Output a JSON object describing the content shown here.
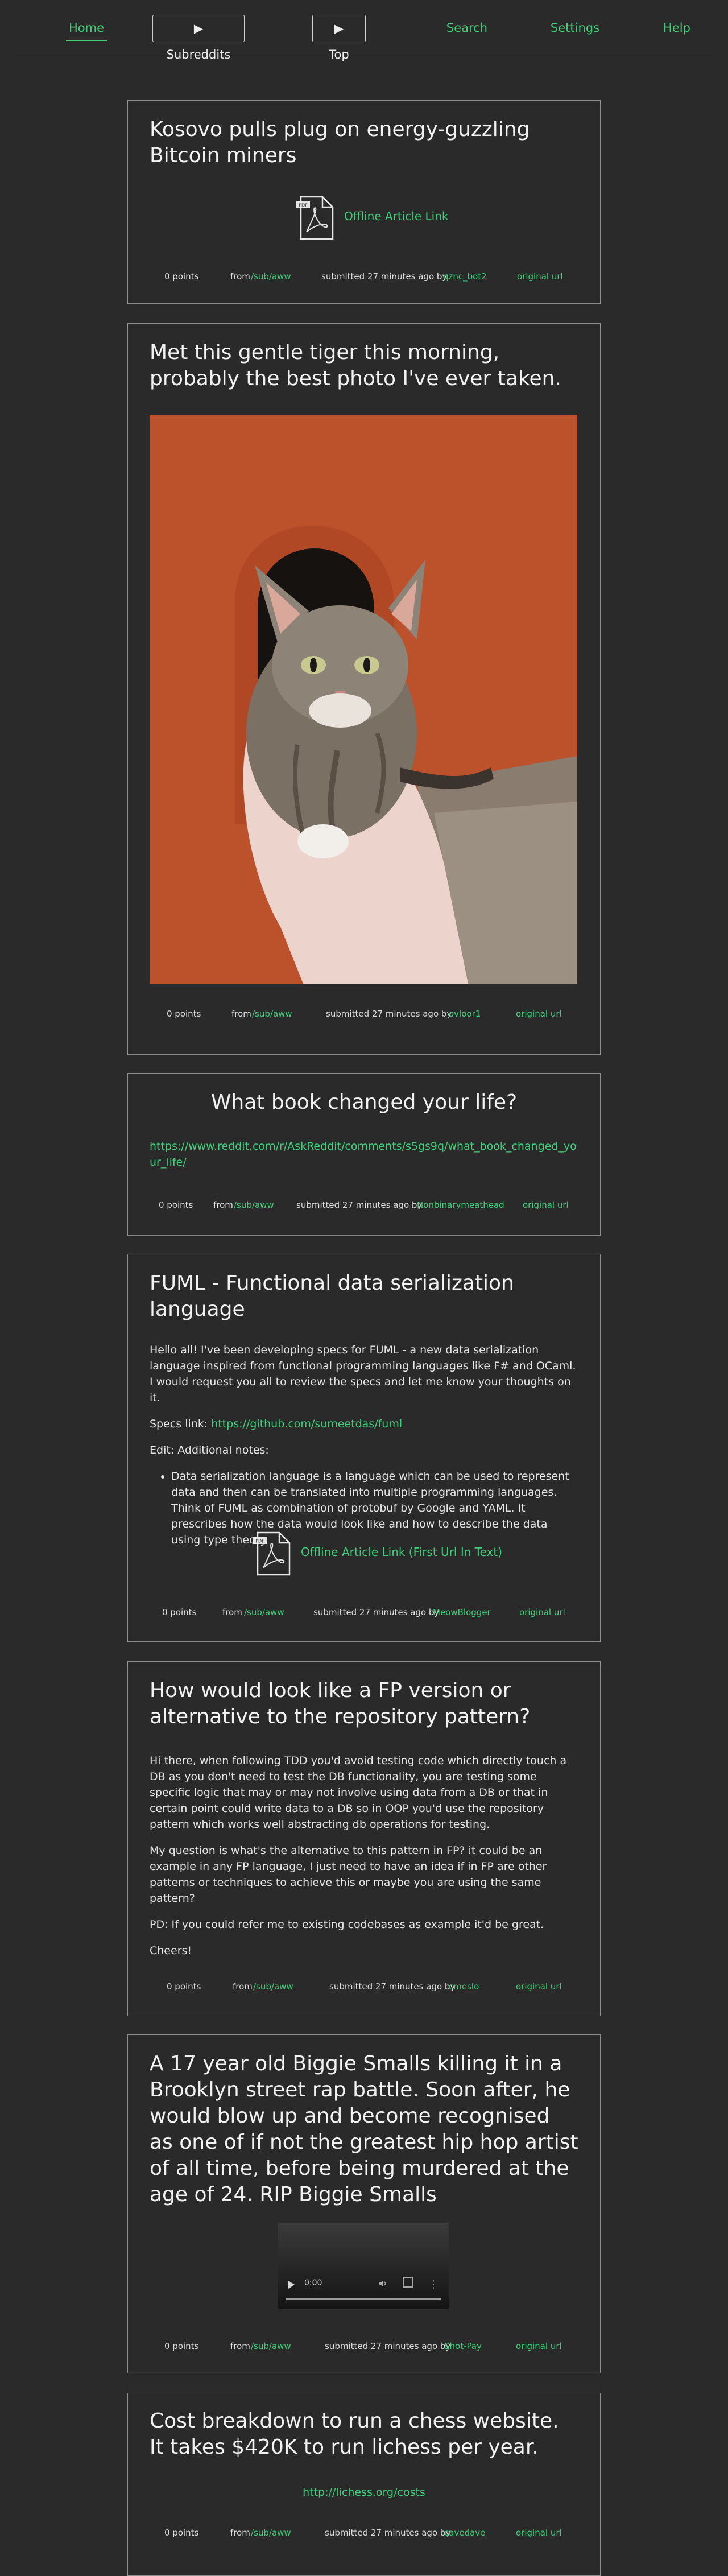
{
  "nav": {
    "home": "Home",
    "subreddits": "▶ Subreddits",
    "top": "▶ Top",
    "search": "Search",
    "settings": "Settings",
    "help": "Help"
  },
  "posts": [
    {
      "title": "Kosovo pulls plug on energy-guzzling Bitcoin miners",
      "link_label": "Offline Article Link",
      "points": "0 points",
      "from": "from",
      "sub": "/sub/aww",
      "submitted": "submitted 27 minutes ago by",
      "user": "qznc_bot2",
      "original": "original url"
    },
    {
      "title": "Met this gentle tiger this morning, probably the best photo I've ever taken.",
      "points": "0 points",
      "from": "from",
      "sub": "/sub/aww",
      "submitted": "submitted 27 minutes ago by",
      "user": "ovloor1",
      "original": "original url"
    },
    {
      "title": "What book changed your life?",
      "url": "https://www.reddit.com/r/AskReddit/comments/s5gs9q/what_book_changed_your_life/",
      "points": "0 points",
      "from": "from",
      "sub": "/sub/aww",
      "submitted": "submitted 27 minutes ago by",
      "user": "Nonbinarymeathead",
      "original": "original url"
    },
    {
      "title": "FUML - Functional data serialization language",
      "para1": "Hello all! I've been developing specs for FUML - a new data serialization language inspired from functional programming languages like F# and OCaml. I would request you all to review the specs and let me know your thoughts on it.",
      "specs_prefix": "Specs link: ",
      "specs_link": "https://github.com/sumeetdas/fuml",
      "edit": "Edit: Additional notes:",
      "bullet": "Data serialization language is a language which can be used to represent data and then can be translated into multiple programming languages. Think of FUML as combination of protobuf by Google and YAML. It prescribes how the data would look like and how to describe the data using type theory.",
      "link_label": "Offline Article Link (First Url In Text)",
      "points": "0 points",
      "from": "from",
      "sub": "/sub/aww",
      "submitted": "submitted 27 minutes ago by",
      "user": "MeowBlogger",
      "original": "original url"
    },
    {
      "title": "How would look like a FP version or alternative to the repository pattern?",
      "para1": "Hi there, when following TDD you'd avoid testing code which directly touch a DB as you don't need to test the DB functionality, you are testing some specific logic that may or may not involve using data from a DB or that in certain point could write data to a DB so in OOP you'd use the repository pattern which works well abstracting db operations for testing.",
      "para2": "My question is what's the alternative to this pattern in FP? it could be an example in any FP language, I just need to have an idea if in FP are other patterns or techniques to achieve this or maybe you are using the same pattern?",
      "para3": "PD: If you could refer me to existing codebases as example it'd be great.",
      "para4": "Cheers!",
      "points": "0 points",
      "from": "from",
      "sub": "/sub/aww",
      "submitted": "submitted 27 minutes ago by",
      "user": "cmeslo",
      "original": "original url"
    },
    {
      "title": "A 17 year old Biggie Smalls killing it in a Brooklyn street rap battle. Soon after, he would blow up and become recognised as one of if not the greatest hip hop artist of all time, before being murdered at the age of 24. RIP Biggie Smalls",
      "video_time": "0:00",
      "points": "0 points",
      "from": "from",
      "sub": "/sub/aww",
      "submitted": "submitted 27 minutes ago by",
      "user": "Shot-Pay",
      "original": "original url"
    },
    {
      "title": "Cost breakdown to run a chess website. It takes $420K to run lichess per year.",
      "url": "http://lichess.org/costs",
      "points": "0 points",
      "from": "from",
      "sub": "/sub/aww",
      "submitted": "submitted 27 minutes ago by",
      "user": "cavedave",
      "original": "original url"
    }
  ]
}
